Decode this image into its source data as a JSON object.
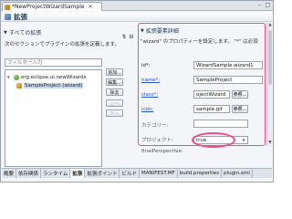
{
  "editor": {
    "tab_title": "*NewProjectWizardSample",
    "close_glyph": "✕",
    "minimize_glyph": "–",
    "maximize_glyph": "□"
  },
  "header": {
    "title": "拡張"
  },
  "all_extensions": {
    "title": "すべての拡張",
    "description": "次のセクションでプラグインの拡張を定義します。",
    "filter_placeholder": "フィルター入力",
    "tree": [
      {
        "label": "org.eclipse.ui.newWizards",
        "expanded": true
      },
      {
        "label": "SampleProject (wizard)",
        "selected": true
      }
    ],
    "buttons": {
      "add": "追加...",
      "edit": "編集...",
      "delete": "除去",
      "up": "上へ",
      "down": "下へ"
    }
  },
  "details": {
    "title": "拡張要素詳細",
    "description": "\"wizard\" のプロパティーを設定します。 \"*\" は必須",
    "fields": {
      "id": {
        "label": "id*:",
        "value": "WizardSample.wizard1"
      },
      "name": {
        "label": "name*:",
        "value": "SampleProject"
      },
      "class": {
        "label": "class*:",
        "value": "ojectWizard"
      },
      "icon": {
        "label": "icon:",
        "value": "sample.gif"
      },
      "category": {
        "label": "カテゴリー:",
        "value": ""
      },
      "project": {
        "label": "プロジェクト:",
        "value": "true"
      },
      "final_perspective": {
        "label": "finalPerspective:"
      }
    },
    "browse_label": "参照..."
  },
  "bottom_tabs": [
    "概要",
    "依存関係",
    "ランタイム",
    "拡張",
    "拡張ポイント",
    "ビルド",
    "MANIFEST.MF",
    "build.properties",
    "plugin.xml"
  ],
  "active_bottom_tab": "拡張",
  "colors": {
    "highlight": "#e8508a",
    "link": "#2a55c4",
    "selection": "#c6d8f0"
  }
}
